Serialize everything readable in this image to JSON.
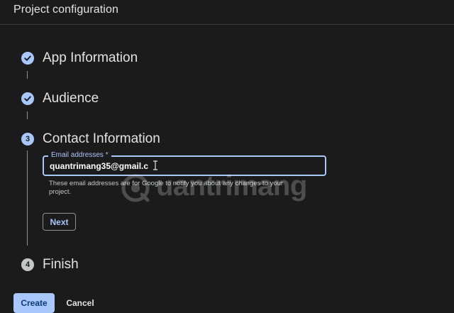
{
  "header": {
    "title": "Project configuration"
  },
  "steps": [
    {
      "number": "1",
      "label": "App Information",
      "state": "completed",
      "icon": "check-icon"
    },
    {
      "number": "2",
      "label": "Audience",
      "state": "completed",
      "icon": "check-icon"
    },
    {
      "number": "3",
      "label": "Contact Information",
      "state": "active"
    },
    {
      "number": "4",
      "label": "Finish",
      "state": "pending"
    }
  ],
  "contact": {
    "field_label": "Email addresses *",
    "field_value": "quantrimang35@gmail.c",
    "hint": "These email addresses are for Google to notify you about any changes to your project.",
    "next_label": "Next"
  },
  "footer": {
    "create_label": "Create",
    "cancel_label": "Cancel"
  },
  "watermark": {
    "text": "uantrimang"
  },
  "colors": {
    "background": "#1b1b1c",
    "accent": "#a8c7fa",
    "text": "#e3e3e3",
    "muted": "#c4c7c5"
  }
}
